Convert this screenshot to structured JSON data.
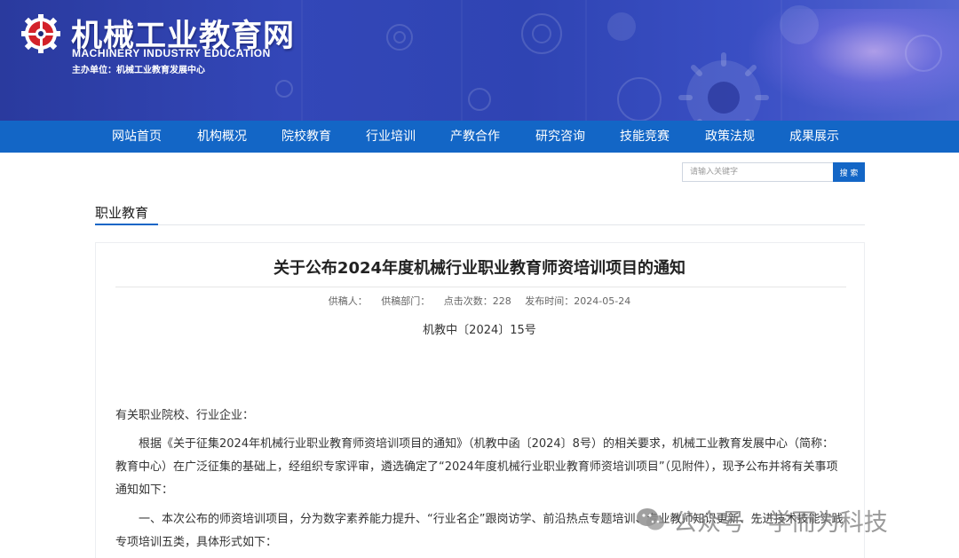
{
  "header": {
    "site_name": "机械工业教育网",
    "site_name_en": "MACHINERY INDUSTRY EDUCATION",
    "host_org": "主办单位：机械工业教育发展中心",
    "colors": {
      "banner": "#2f44b3",
      "nav": "#1366c6",
      "logo_red": "#d3222a"
    }
  },
  "nav": {
    "items": [
      {
        "label": "网站首页"
      },
      {
        "label": "机构概况"
      },
      {
        "label": "院校教育"
      },
      {
        "label": "行业培训"
      },
      {
        "label": "产教合作"
      },
      {
        "label": "研究咨询"
      },
      {
        "label": "技能竞赛"
      },
      {
        "label": "政策法规"
      },
      {
        "label": "成果展示"
      }
    ]
  },
  "search": {
    "placeholder": "请输入关键字",
    "button_label": "搜 索"
  },
  "section": {
    "title": "职业教育"
  },
  "article": {
    "title": "关于公布2024年度机械行业职业教育师资培训项目的通知",
    "meta": {
      "contributor": "供稿人：",
      "department": "供稿部门：",
      "clicks": "点击次数：228",
      "published": "发布时间：2024-05-24"
    },
    "doc_number": "机教中〔2024〕15号",
    "addressee": "有关职业院校、行业企业：",
    "body1": "根据《关于征集2024年机械行业职业教育师资培训项目的通知》（机教中函〔2024〕8号）的相关要求，机械工业教育发展中心（简称：教育中心）在广泛征集的基础上，经组织专家评审，遴选确定了“2024年度机械行业职业教育师资培训项目”（见附件），现予公布并将有关事项通知如下：",
    "body2": "一、本次公布的师资培训项目，分为数字素养能力提升、“行业名企”跟岗访学、前沿热点专题培训、专业教师知识更新、先进技术技能实践专项培训五类，具体形式如下："
  },
  "watermark": {
    "text": "公众号 · 学而为科技",
    "icon": "wechat-icon"
  }
}
